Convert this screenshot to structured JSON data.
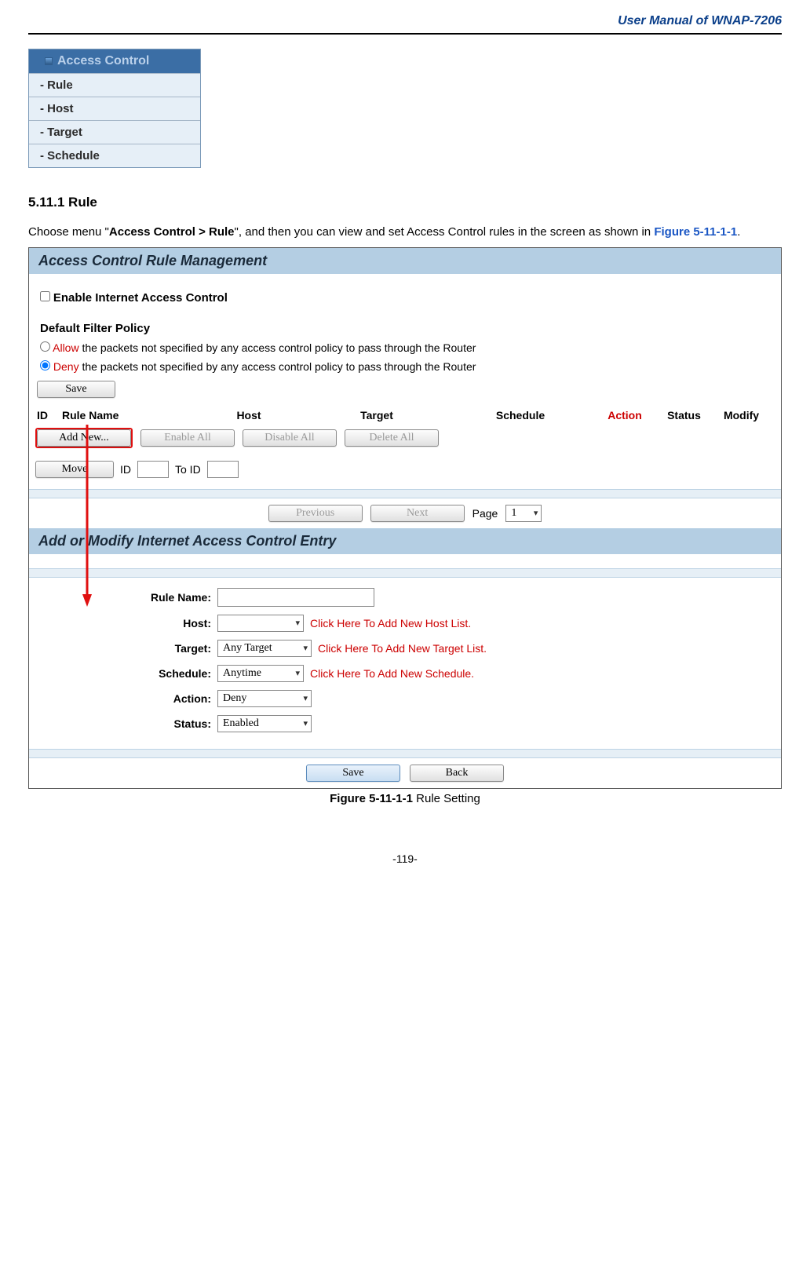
{
  "doc_header": "User Manual of WNAP-7206",
  "nav": {
    "header": "Access Control",
    "items": [
      {
        "label": "- Rule"
      },
      {
        "label": "- Host"
      },
      {
        "label": "- Target"
      },
      {
        "label": "- Schedule"
      }
    ]
  },
  "section": {
    "num_title": "5.11.1 Rule",
    "para_a": "Choose menu \"",
    "para_bold": "Access Control > Rule",
    "para_b": "\", and then you can view and set Access Control rules in the screen as shown in ",
    "fig_ref": "Figure 5-11-1-1",
    "para_c": "."
  },
  "panel1": {
    "title": "Access Control Rule Management",
    "enable_label": "Enable Internet Access Control",
    "default_policy_label": "Default Filter Policy",
    "radio_allow_red": "Allow",
    "radio_allow_rest": " the packets not specified by any access control policy to pass through the Router",
    "radio_deny_red": "Deny",
    "radio_deny_rest": " the packets not specified by any access control policy to pass through the Router",
    "save_label": "Save",
    "headers": {
      "id": "ID",
      "rule": "Rule Name",
      "host": "Host",
      "target": "Target",
      "schedule": "Schedule",
      "action": "Action",
      "status": "Status",
      "modify": "Modify"
    },
    "buttons": {
      "add_new": "Add New...",
      "enable_all": "Enable All",
      "disable_all": "Disable All",
      "delete_all": "Delete All",
      "move": "Move",
      "id_lbl": "ID",
      "to_id_lbl": "To ID",
      "previous": "Previous",
      "next": "Next",
      "page_lbl": "Page",
      "page_sel": "1"
    }
  },
  "panel2": {
    "title": "Add or Modify Internet Access Control Entry",
    "rows": {
      "rule_name_lbl": "Rule Name:",
      "host_lbl": "Host:",
      "host_link": "Click Here To Add New Host List.",
      "target_lbl": "Target:",
      "target_sel": "Any Target",
      "target_link": "Click Here To Add New Target List.",
      "schedule_lbl": "Schedule:",
      "schedule_sel": "Anytime",
      "schedule_link": "Click Here To Add New Schedule.",
      "action_lbl": "Action:",
      "action_sel": "Deny",
      "status_lbl": "Status:",
      "status_sel": "Enabled"
    },
    "save_btn": "Save",
    "back_btn": "Back"
  },
  "caption": {
    "bold": "Figure 5-11-1-1",
    "rest": " Rule Setting"
  },
  "page_no": "-119-"
}
